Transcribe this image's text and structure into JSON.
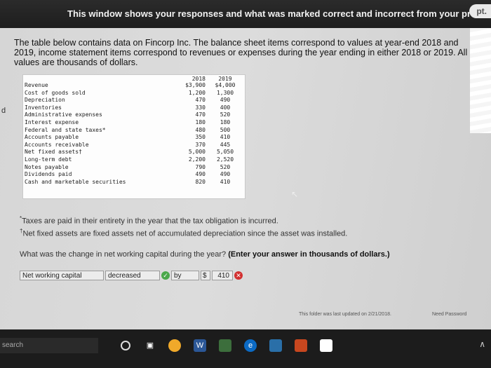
{
  "banner": {
    "text": "This window shows your responses and what was marked correct and incorrect from your previous at",
    "pill": "pt."
  },
  "intro": "The table below contains data on Fincorp Inc. The balance sheet items correspond to values at year-end 2018 and 2019, income statement items correspond to revenues or expenses during the year ending in either 2018 or 2019. All values are thousands of dollars.",
  "left_marker": "d",
  "table": {
    "headers": [
      "2018",
      "2019"
    ],
    "rows": [
      {
        "label": "Revenue",
        "y2018": "$3,900",
        "y2019": "$4,000"
      },
      {
        "label": "Cost of goods sold",
        "y2018": "1,200",
        "y2019": "1,300"
      },
      {
        "label": "Depreciation",
        "y2018": "470",
        "y2019": "490"
      },
      {
        "label": "Inventories",
        "y2018": "330",
        "y2019": "400"
      },
      {
        "label": "Administrative expenses",
        "y2018": "470",
        "y2019": "520"
      },
      {
        "label": "Interest expense",
        "y2018": "180",
        "y2019": "180"
      },
      {
        "label": "Federal and state taxes*",
        "y2018": "480",
        "y2019": "500"
      },
      {
        "label": "Accounts payable",
        "y2018": "350",
        "y2019": "410"
      },
      {
        "label": "Accounts receivable",
        "y2018": "370",
        "y2019": "445"
      },
      {
        "label": "Net fixed assets†",
        "y2018": "5,000",
        "y2019": "5,050"
      },
      {
        "label": "Long-term debt",
        "y2018": "2,200",
        "y2019": "2,520"
      },
      {
        "label": "Notes payable",
        "y2018": "790",
        "y2019": "520"
      },
      {
        "label": "Dividends paid",
        "y2018": "490",
        "y2019": "490"
      },
      {
        "label": "Cash and marketable securities",
        "y2018": "820",
        "y2019": "410"
      }
    ]
  },
  "notes": {
    "tax_mark": "*",
    "tax": "Taxes are paid in their entirety in the year that the tax obligation is incurred.",
    "nfa_mark": "†",
    "nfa": "Net fixed assets are fixed assets net of accumulated depreciation since the asset was installed."
  },
  "question": {
    "text": "What was the change in net working capital during the year?",
    "instruction": "(Enter your answer in thousands of dollars.)"
  },
  "answer": {
    "label": "Net working capital",
    "direction": "decreased",
    "by": "by",
    "currency": "$",
    "value": "410"
  },
  "footer": {
    "updated": "This folder was last updated on 2/21/2018.",
    "password": "Need Password"
  },
  "taskbar": {
    "search": "search"
  }
}
